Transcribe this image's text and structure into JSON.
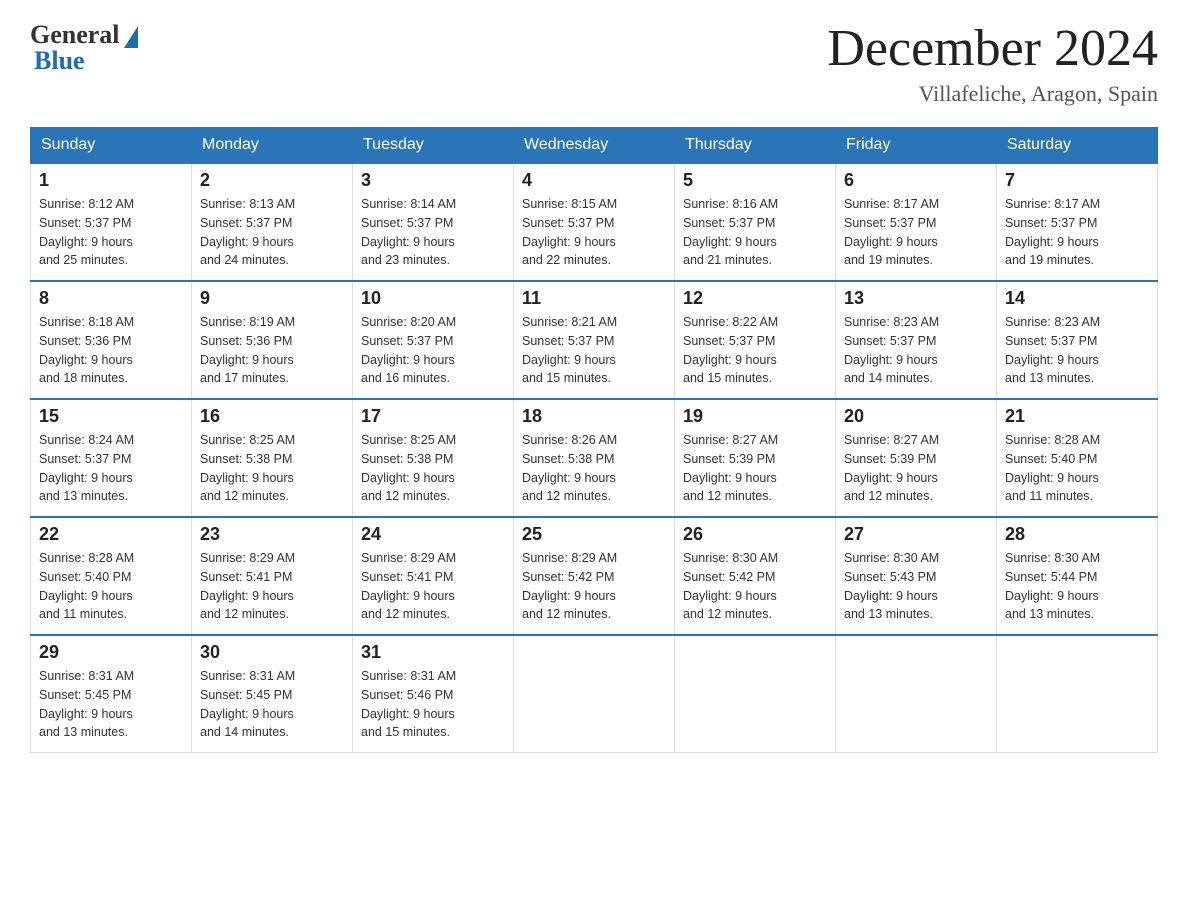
{
  "logo": {
    "general": "General",
    "blue": "Blue"
  },
  "header": {
    "month": "December 2024",
    "location": "Villafeliche, Aragon, Spain"
  },
  "weekdays": [
    "Sunday",
    "Monday",
    "Tuesday",
    "Wednesday",
    "Thursday",
    "Friday",
    "Saturday"
  ],
  "weeks": [
    [
      {
        "day": "1",
        "sunrise": "8:12 AM",
        "sunset": "5:37 PM",
        "daylight": "9 hours and 25 minutes."
      },
      {
        "day": "2",
        "sunrise": "8:13 AM",
        "sunset": "5:37 PM",
        "daylight": "9 hours and 24 minutes."
      },
      {
        "day": "3",
        "sunrise": "8:14 AM",
        "sunset": "5:37 PM",
        "daylight": "9 hours and 23 minutes."
      },
      {
        "day": "4",
        "sunrise": "8:15 AM",
        "sunset": "5:37 PM",
        "daylight": "9 hours and 22 minutes."
      },
      {
        "day": "5",
        "sunrise": "8:16 AM",
        "sunset": "5:37 PM",
        "daylight": "9 hours and 21 minutes."
      },
      {
        "day": "6",
        "sunrise": "8:17 AM",
        "sunset": "5:37 PM",
        "daylight": "9 hours and 19 minutes."
      },
      {
        "day": "7",
        "sunrise": "8:17 AM",
        "sunset": "5:37 PM",
        "daylight": "9 hours and 19 minutes."
      }
    ],
    [
      {
        "day": "8",
        "sunrise": "8:18 AM",
        "sunset": "5:36 PM",
        "daylight": "9 hours and 18 minutes."
      },
      {
        "day": "9",
        "sunrise": "8:19 AM",
        "sunset": "5:36 PM",
        "daylight": "9 hours and 17 minutes."
      },
      {
        "day": "10",
        "sunrise": "8:20 AM",
        "sunset": "5:37 PM",
        "daylight": "9 hours and 16 minutes."
      },
      {
        "day": "11",
        "sunrise": "8:21 AM",
        "sunset": "5:37 PM",
        "daylight": "9 hours and 15 minutes."
      },
      {
        "day": "12",
        "sunrise": "8:22 AM",
        "sunset": "5:37 PM",
        "daylight": "9 hours and 15 minutes."
      },
      {
        "day": "13",
        "sunrise": "8:23 AM",
        "sunset": "5:37 PM",
        "daylight": "9 hours and 14 minutes."
      },
      {
        "day": "14",
        "sunrise": "8:23 AM",
        "sunset": "5:37 PM",
        "daylight": "9 hours and 13 minutes."
      }
    ],
    [
      {
        "day": "15",
        "sunrise": "8:24 AM",
        "sunset": "5:37 PM",
        "daylight": "9 hours and 13 minutes."
      },
      {
        "day": "16",
        "sunrise": "8:25 AM",
        "sunset": "5:38 PM",
        "daylight": "9 hours and 12 minutes."
      },
      {
        "day": "17",
        "sunrise": "8:25 AM",
        "sunset": "5:38 PM",
        "daylight": "9 hours and 12 minutes."
      },
      {
        "day": "18",
        "sunrise": "8:26 AM",
        "sunset": "5:38 PM",
        "daylight": "9 hours and 12 minutes."
      },
      {
        "day": "19",
        "sunrise": "8:27 AM",
        "sunset": "5:39 PM",
        "daylight": "9 hours and 12 minutes."
      },
      {
        "day": "20",
        "sunrise": "8:27 AM",
        "sunset": "5:39 PM",
        "daylight": "9 hours and 12 minutes."
      },
      {
        "day": "21",
        "sunrise": "8:28 AM",
        "sunset": "5:40 PM",
        "daylight": "9 hours and 11 minutes."
      }
    ],
    [
      {
        "day": "22",
        "sunrise": "8:28 AM",
        "sunset": "5:40 PM",
        "daylight": "9 hours and 11 minutes."
      },
      {
        "day": "23",
        "sunrise": "8:29 AM",
        "sunset": "5:41 PM",
        "daylight": "9 hours and 12 minutes."
      },
      {
        "day": "24",
        "sunrise": "8:29 AM",
        "sunset": "5:41 PM",
        "daylight": "9 hours and 12 minutes."
      },
      {
        "day": "25",
        "sunrise": "8:29 AM",
        "sunset": "5:42 PM",
        "daylight": "9 hours and 12 minutes."
      },
      {
        "day": "26",
        "sunrise": "8:30 AM",
        "sunset": "5:42 PM",
        "daylight": "9 hours and 12 minutes."
      },
      {
        "day": "27",
        "sunrise": "8:30 AM",
        "sunset": "5:43 PM",
        "daylight": "9 hours and 13 minutes."
      },
      {
        "day": "28",
        "sunrise": "8:30 AM",
        "sunset": "5:44 PM",
        "daylight": "9 hours and 13 minutes."
      }
    ],
    [
      {
        "day": "29",
        "sunrise": "8:31 AM",
        "sunset": "5:45 PM",
        "daylight": "9 hours and 13 minutes."
      },
      {
        "day": "30",
        "sunrise": "8:31 AM",
        "sunset": "5:45 PM",
        "daylight": "9 hours and 14 minutes."
      },
      {
        "day": "31",
        "sunrise": "8:31 AM",
        "sunset": "5:46 PM",
        "daylight": "9 hours and 15 minutes."
      },
      null,
      null,
      null,
      null
    ]
  ],
  "labels": {
    "sunrise": "Sunrise:",
    "sunset": "Sunset:",
    "daylight": "Daylight:"
  }
}
